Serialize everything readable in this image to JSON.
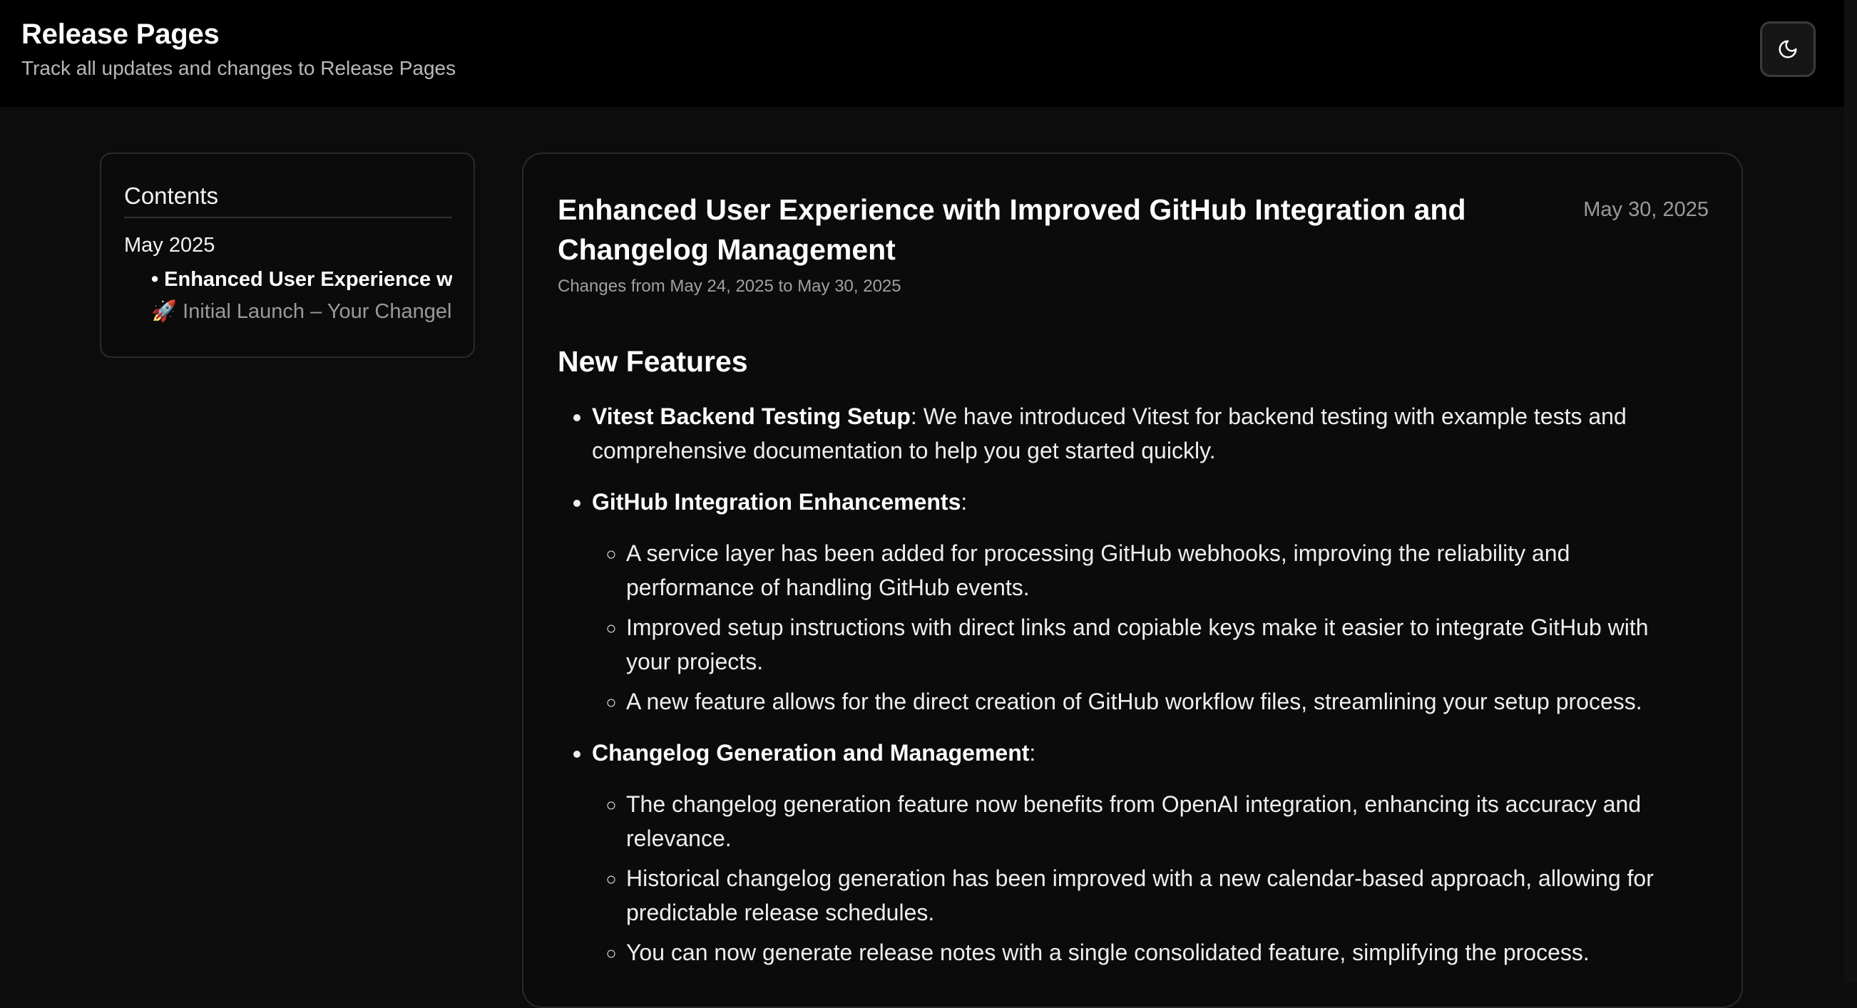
{
  "header": {
    "title": "Release Pages",
    "subtitle": "Track all updates and changes to Release Pages",
    "theme_toggle_icon": "moon-icon"
  },
  "toc": {
    "title": "Contents",
    "month": "May 2025",
    "items": [
      {
        "label": "Enhanced User Experience w",
        "active": true
      },
      {
        "label": "🚀 Initial Launch – Your Changelo",
        "active": false
      }
    ]
  },
  "post": {
    "title": "Enhanced User Experience with Improved GitHub Integration and Changelog Management",
    "date": "May 30, 2025",
    "range": "Changes from May 24, 2025 to May 30, 2025",
    "section_heading": "New Features",
    "features": [
      {
        "name": "Vitest Backend Testing Setup",
        "suffix": ": We have introduced Vitest for backend testing with example tests and comprehensive documentation to help you get started quickly."
      },
      {
        "name": "GitHub Integration Enhancements",
        "suffix": ":",
        "sub": [
          "A service layer has been added for processing GitHub webhooks, improving the reliability and performance of handling GitHub events.",
          "Improved setup instructions with direct links and copiable keys make it easier to integrate GitHub with your projects.",
          "A new feature allows for the direct creation of GitHub workflow files, streamlining your setup process."
        ]
      },
      {
        "name": "Changelog Generation and Management",
        "suffix": ":",
        "sub": [
          "The changelog generation feature now benefits from OpenAI integration, enhancing its accuracy and relevance.",
          "Historical changelog generation has been improved with a new calendar-based approach, allowing for predictable release schedules.",
          "You can now generate release notes with a single consolidated feature, simplifying the process."
        ]
      }
    ]
  }
}
